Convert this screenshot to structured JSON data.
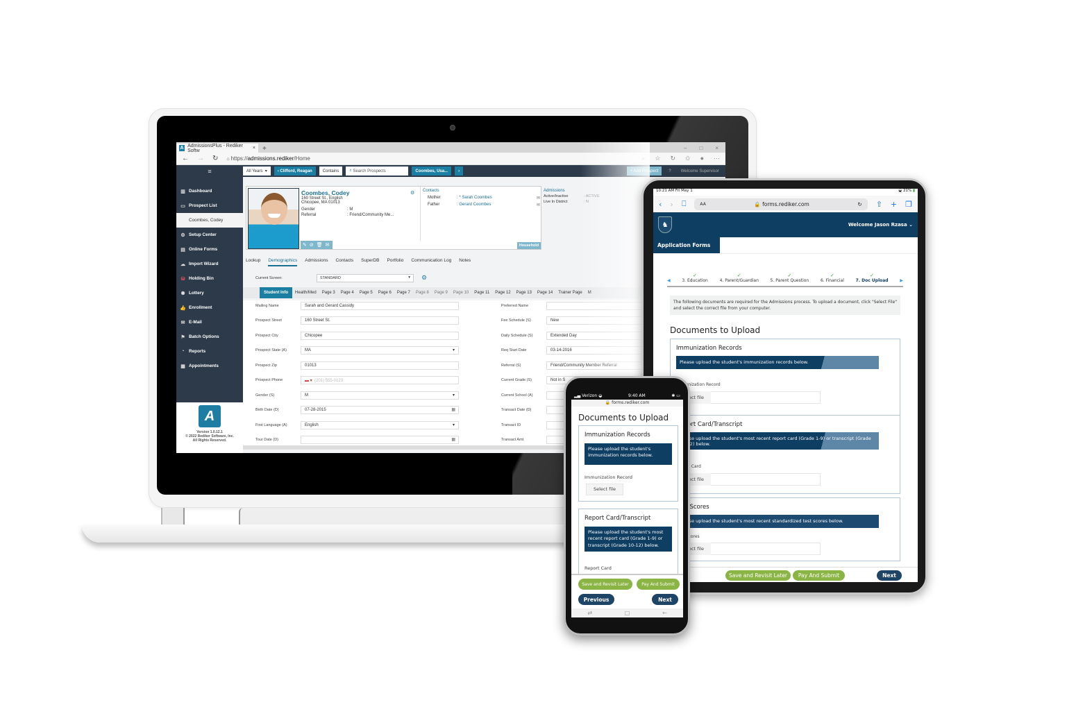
{
  "laptop": {
    "browser": {
      "tab_title": "AdmissionsPlus - Rediker Softw",
      "tab_icon": "A",
      "new_tab": "+",
      "window_controls": [
        "–",
        "□",
        "×"
      ],
      "url_prefix": "https://",
      "url_host": "admissions.rediker",
      "url_path": "/Home",
      "nav": {
        "back": "←",
        "forward": "→",
        "reload": "↻",
        "lock": "🔒"
      },
      "toolbar_icons": [
        "zoom-icon",
        "favorite-add-icon",
        "extensions-icon",
        "favorites-icon",
        "profile-icon",
        "more-icon"
      ]
    },
    "app": {
      "menu_icon": "≡",
      "year_select": "All Years",
      "prev_prospect": "‹ Clifford, Reagan",
      "search_mode": "Contains",
      "search_placeholder": "Search Prospects",
      "next_prospect": "Coombes, Usa...",
      "next_arrow": "›",
      "add_prospect": "+ Add Prospect",
      "help": "?",
      "welcome": "Welcome Supervisor",
      "sidebar": {
        "items": [
          {
            "label": "Dashboard",
            "icon": "▥"
          },
          {
            "label": "Prospect List",
            "icon": "▭"
          },
          {
            "label": "Coombes, Codey",
            "icon": ""
          },
          {
            "label": "Setup Center",
            "icon": "⚙"
          },
          {
            "label": "Online Forms",
            "icon": "▤"
          },
          {
            "label": "Import Wizard",
            "icon": "☁"
          },
          {
            "label": "Holding Bin",
            "icon": "⛁"
          },
          {
            "label": "Lottery",
            "icon": "✺"
          },
          {
            "label": "Enrollment",
            "icon": "👍"
          },
          {
            "label": "E-Mail",
            "icon": "✉"
          },
          {
            "label": "Batch Options",
            "icon": "⚑"
          },
          {
            "label": "Reports",
            "icon": "◔"
          },
          {
            "label": "Appointments",
            "icon": "▦"
          }
        ],
        "logo": "A",
        "version": "Version 1.0.12.1",
        "copyright": "© 2022 Rediker Software, Inc.",
        "rights": "All Rights Reserved."
      },
      "profile": {
        "name": "Coombes, Codey",
        "address1": "160 Street St., English",
        "address2": "Chicopee, MA 01013",
        "fields": [
          {
            "label": "Gender",
            "value": ": M"
          },
          {
            "label": "Referral",
            "value": ": Friend/Community Me..."
          }
        ],
        "actions": [
          "✎",
          "⊘",
          "🗑",
          "✉"
        ],
        "contacts_title": "Contacts",
        "contacts": [
          {
            "relation": "Mother",
            "name": ": * Sarah Coombes"
          },
          {
            "relation": "Father",
            "name": ": Gerard Coombes"
          }
        ],
        "household_button": "Household",
        "admissions_title": "Admissions",
        "admissions": [
          {
            "label": "Active/Inactive",
            "value": ": ACTIVE"
          },
          {
            "label": "Live In District",
            "value": ": N"
          }
        ]
      },
      "subtabs": [
        "Lookup",
        "Demographics",
        "Admissions",
        "Contacts",
        "SuperDB",
        "Portfolio",
        "Communication Log",
        "Notes"
      ],
      "current_screen_label": "Current Screen:",
      "current_screen_value": "STANDARD",
      "page_tabs": [
        "Student Info",
        "Health/Med",
        "Page 3",
        "Page 4",
        "Page 5",
        "Page 6",
        "Page 7",
        "Page 8",
        "Page 9",
        "Page 10",
        "Page 11",
        "Page 12",
        "Page 13",
        "Page 14",
        "Trainer Page",
        "M"
      ],
      "form_left": [
        {
          "label": "Mailing Name",
          "value": "Sarah and Gerard Cassidy",
          "type": "text"
        },
        {
          "label": "Prospect Street",
          "value": "160 Street St.",
          "type": "text"
        },
        {
          "label": "Prospect City",
          "value": "Chicopee",
          "type": "text"
        },
        {
          "label": "Prospect State (A)",
          "value": "MA",
          "type": "select"
        },
        {
          "label": "Prospect Zip",
          "value": "01013",
          "type": "text"
        },
        {
          "label": "Prospect Phone",
          "value": "",
          "placeholder": "(201) 555-0123",
          "type": "phone"
        },
        {
          "label": "Gender (S)",
          "value": "M",
          "type": "select"
        },
        {
          "label": "Birth Date (D)",
          "value": "07-28-2015",
          "type": "date"
        },
        {
          "label": "First Language (A)",
          "value": "English",
          "type": "select"
        },
        {
          "label": "Tour Date (D)",
          "value": "",
          "type": "date"
        }
      ],
      "form_right": [
        {
          "label": "Preferred Name",
          "value": ""
        },
        {
          "label": "Fee Schedule (S)",
          "value": "New"
        },
        {
          "label": "Daily Schedule (S)",
          "value": "Extended Day"
        },
        {
          "label": "Req Start Date",
          "value": "03-14-2016"
        },
        {
          "label": "Referral (S)",
          "value": "Friend/Community Member Referral"
        },
        {
          "label": "Current Grade (S)",
          "value": "Not in S"
        },
        {
          "label": "Current School (A)",
          "value": ""
        },
        {
          "label": "Transact Date (D)",
          "value": ""
        },
        {
          "label": "Transact ID",
          "value": ""
        },
        {
          "label": "Transact Amt",
          "value": ""
        }
      ]
    }
  },
  "tablet": {
    "status_time": "10:21 AM  Fri May 1",
    "status_battery": "21%",
    "safari": {
      "text_size": "AA",
      "url": "🔒 forms.rediker.com",
      "back": "‹",
      "forward": "›",
      "bookmarks": "📖",
      "reload": "↻",
      "share": "⇧",
      "new_tab": "+",
      "tabs": "❐"
    },
    "header": {
      "crest": "♞",
      "welcome": "Welcome Jason Rzasa ⌄"
    },
    "nav_title": "Application Forms",
    "steps": [
      {
        "label": "3. Education",
        "done": true
      },
      {
        "label": "4. Parent/Guardian",
        "done": true
      },
      {
        "label": "5. Parent Question",
        "done": true
      },
      {
        "label": "6. Financial",
        "done": true
      },
      {
        "label": "7. Doc Upload",
        "done": true,
        "active": true
      }
    ],
    "check": "✓",
    "prev_arrow": "◀",
    "next_arrow": "▶",
    "info": "The following documents are required for the Admissions process. To upload a document, click \"Select File\" and select the correct file from your computer.",
    "docs_title": "Documents to Upload",
    "cards": [
      {
        "title": "Immunization Records",
        "banner": "Please upload the student's immunization records below.",
        "field_label": "Immunization Record",
        "button": "Select file"
      },
      {
        "title": "Report Card/Transcript",
        "banner": "Please upload the student's most recent report card (Grade 1-9) or transcript (Grade 10-12) below.",
        "field_label": "Report Card",
        "button": "Select file"
      },
      {
        "title": "Test Scores",
        "banner": "Please upload the student's most recent standardized test scores below.",
        "field_label": "Test Scores",
        "button": "Select file"
      }
    ],
    "buttons": {
      "save": "Save and Revisit Later",
      "pay": "Pay And Submit",
      "next": "Next"
    }
  },
  "phone": {
    "carrier": "Verizon",
    "time": "9:40 AM",
    "url": "🔒 forms.rediker.com",
    "title": "Documents to Upload",
    "cards": [
      {
        "title": "Immunization Records",
        "banner": "Please upload the student's immunization records below.",
        "field_label": "Immunization Record",
        "button": "Select file"
      },
      {
        "title": "Report Card/Transcript",
        "banner": "Please upload the student's most recent report card (Grade 1-9) or transcript (Grade 10-12) below.",
        "field_label": "Report Card"
      }
    ],
    "buttons": {
      "save": "Save and Revisit Later",
      "pay": "Pay And Submit",
      "previous": "Previous",
      "next": "Next"
    },
    "navbar": [
      "⇄",
      "□",
      "←"
    ]
  },
  "colors": {
    "app_dark": "#2c3a4a",
    "app_accent": "#1a7fa3",
    "forms_navy": "#0f3e63",
    "forms_green": "#8ab444"
  }
}
